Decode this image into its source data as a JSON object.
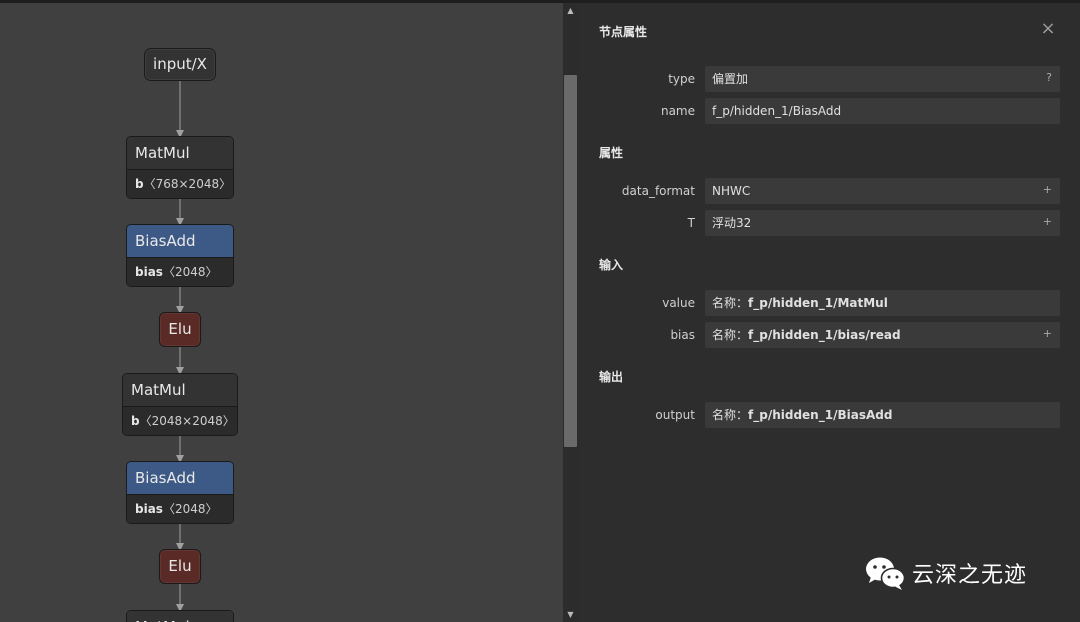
{
  "graph": {
    "input_node": "input/X",
    "nodes": [
      {
        "type": "MatMul",
        "attr_name": "b",
        "attr_value": "〈768×2048〉"
      },
      {
        "type": "BiasAdd",
        "attr_name": "bias",
        "attr_value": "〈2048〉"
      },
      {
        "type": "Elu"
      },
      {
        "type": "MatMul",
        "attr_name": "b",
        "attr_value": "〈2048×2048〉"
      },
      {
        "type": "BiasAdd",
        "attr_name": "bias",
        "attr_value": "〈2048〉"
      },
      {
        "type": "Elu"
      },
      {
        "type": "MatMul"
      }
    ]
  },
  "panel": {
    "title": "节点属性",
    "close_icon": "×",
    "node": {
      "type_label": "type",
      "type_value": "偏置加",
      "type_help": "?",
      "name_label": "name",
      "name_value": "f_p/hidden_1/BiasAdd"
    },
    "attributes": {
      "heading": "属性",
      "items": [
        {
          "label": "data_format",
          "value": "NHWC",
          "button": "+"
        },
        {
          "label": "T",
          "value": "浮动32",
          "button": "+"
        }
      ]
    },
    "inputs": {
      "heading": "输入",
      "items": [
        {
          "label": "value",
          "prefix": "名称：",
          "value": "f_p/hidden_1/MatMul"
        },
        {
          "label": "bias",
          "prefix": "名称：",
          "value": "f_p/hidden_1/bias/read",
          "button": "+"
        }
      ]
    },
    "outputs": {
      "heading": "输出",
      "items": [
        {
          "label": "output",
          "prefix": "名称：",
          "value": "f_p/hidden_1/BiasAdd"
        }
      ]
    }
  },
  "scrollbar": {
    "up_icon": "▲",
    "down_icon": "▼"
  },
  "watermark": {
    "text": "云深之无迹",
    "logo_icon": "wechat-icon"
  },
  "colors": {
    "canvas_bg": "#404040",
    "panel_bg": "#2d2d2d",
    "node_header": "#333333",
    "biasadd_header": "#3d5a86",
    "activation_node": "#5a2a26"
  }
}
